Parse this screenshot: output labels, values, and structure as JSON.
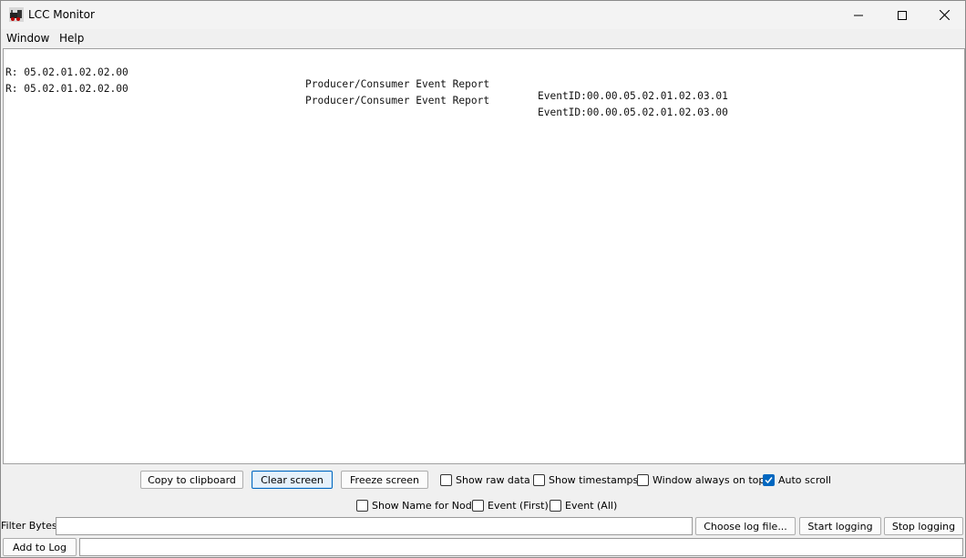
{
  "window": {
    "title": "LCC Monitor"
  },
  "menu": {
    "items": [
      "Window",
      "Help"
    ]
  },
  "log": {
    "lines": [
      {
        "prefix": "R: 05.02.01.02.02.00",
        "message": "Producer/Consumer Event Report",
        "event": "EventID:00.00.05.02.01.02.03.01"
      },
      {
        "prefix": "R: 05.02.01.02.02.00",
        "message": "Producer/Consumer Event Report",
        "event": "EventID:00.00.05.02.01.02.03.00"
      }
    ]
  },
  "controls": {
    "copy_label": "Copy to clipboard",
    "clear_label": "Clear screen",
    "freeze_label": "Freeze screen",
    "show_raw_data": {
      "label": "Show raw data",
      "checked": false
    },
    "show_timestamps": {
      "label": "Show timestamps",
      "checked": false
    },
    "window_on_top": {
      "label": "Window always on top",
      "checked": false
    },
    "auto_scroll": {
      "label": "Auto scroll",
      "checked": true
    },
    "show_name_for_node": {
      "label": "Show Name for Node",
      "checked": false
    },
    "event_first": {
      "label": "Event (First)",
      "checked": false
    },
    "event_all": {
      "label": "Event (All)",
      "checked": false
    },
    "filter_label": "Filter Bytes:",
    "filter_value": "",
    "choose_log_label": "Choose log file...",
    "start_logging_label": "Start logging",
    "stop_logging_label": "Stop logging",
    "add_to_log_label": "Add to Log",
    "add_to_log_value": ""
  },
  "colors": {
    "accent": "#0067c0"
  }
}
